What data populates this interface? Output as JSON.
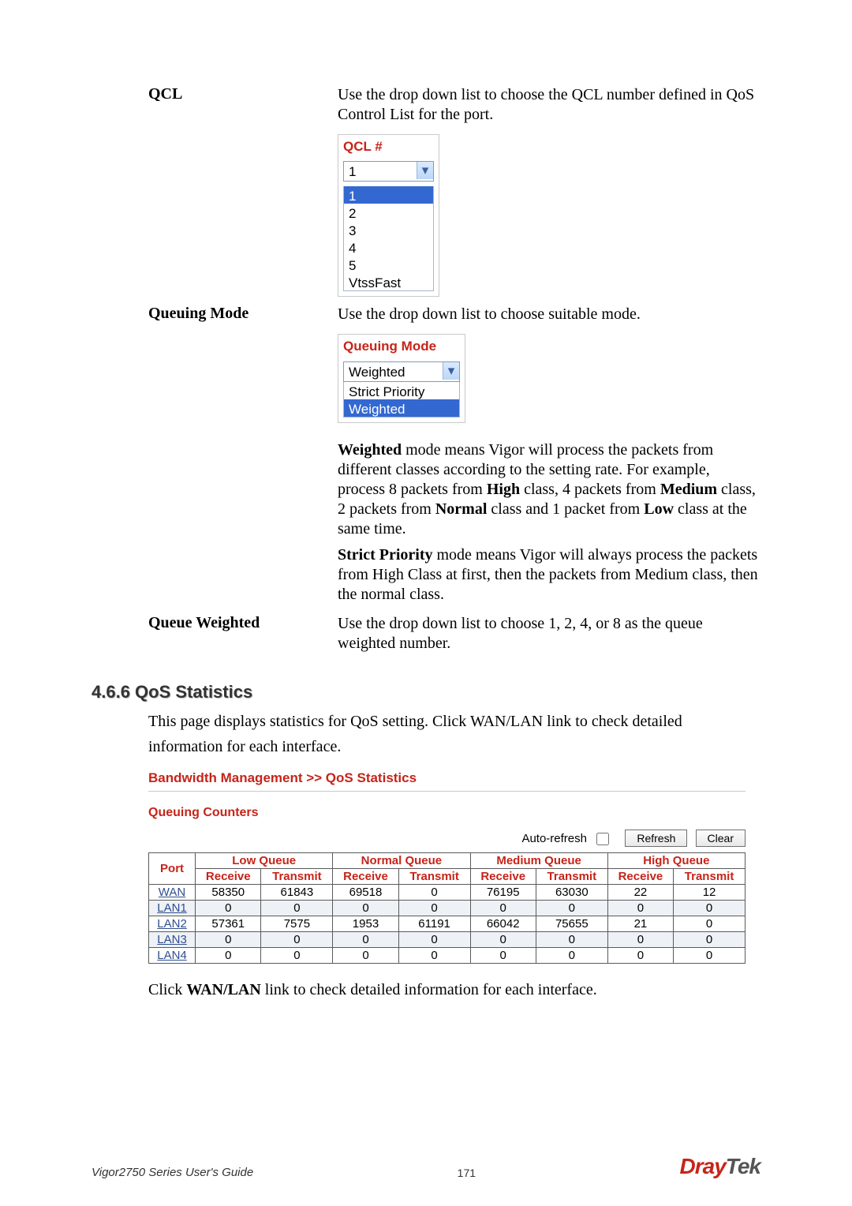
{
  "defs": {
    "qcl": {
      "label": "QCL",
      "text": "Use the drop down list to choose the QCL number defined in QoS Control List for the port.",
      "panel_title": "QCL #",
      "selected": "1",
      "options": [
        "1",
        "2",
        "3",
        "4",
        "5",
        "VtssFast"
      ]
    },
    "queuing_mode": {
      "label": "Queuing Mode",
      "text": "Use the drop down list to choose suitable mode.",
      "panel_title": "Queuing Mode",
      "selected": "Weighted",
      "options": [
        "Strict Priority",
        "Weighted"
      ],
      "weighted_p1_a": "Weighted",
      "weighted_p1_b": " mode means Vigor will process the packets from different classes according to the setting rate. For example, process 8 packets from ",
      "weighted_p1_c": "High",
      "weighted_p1_d": " class, 4 packets from ",
      "weighted_p1_e": "Medium",
      "weighted_p1_f": " class, 2 packets from ",
      "weighted_p1_g": "Normal",
      "weighted_p1_h": " class and 1 packet from ",
      "weighted_p1_i": "Low",
      "weighted_p1_j": " class at the same time.",
      "strict_a": "Strict Priority",
      "strict_b": " mode means Vigor will always process the packets from High Class at first, then the packets from Medium class, then the normal class."
    },
    "queue_weighted": {
      "label": "Queue Weighted",
      "text": "Use the drop down list to choose 1, 2, 4, or 8 as the queue weighted number."
    }
  },
  "section": {
    "heading": "4.6.6 QoS Statistics",
    "intro": "This page displays statistics for QoS setting. Click WAN/LAN link to check detailed information for each interface."
  },
  "stats": {
    "title": "Bandwidth Management >> QoS Statistics",
    "sub": "Queuing Counters",
    "auto_refresh": "Auto-refresh",
    "refresh": "Refresh",
    "clear": "Clear",
    "headers": {
      "port": "Port",
      "groups": [
        "Low Queue",
        "Normal Queue",
        "Medium Queue",
        "High Queue"
      ],
      "sub": [
        "Receive",
        "Transmit"
      ]
    },
    "rows": [
      {
        "port": "WAN",
        "cells": [
          "58350",
          "61843",
          "69518",
          "0",
          "76195",
          "63030",
          "22",
          "12"
        ],
        "even": false
      },
      {
        "port": "LAN1",
        "cells": [
          "0",
          "0",
          "0",
          "0",
          "0",
          "0",
          "0",
          "0"
        ],
        "even": true
      },
      {
        "port": "LAN2",
        "cells": [
          "57361",
          "7575",
          "1953",
          "61191",
          "66042",
          "75655",
          "21",
          "0"
        ],
        "even": false
      },
      {
        "port": "LAN3",
        "cells": [
          "0",
          "0",
          "0",
          "0",
          "0",
          "0",
          "0",
          "0"
        ],
        "even": true
      },
      {
        "port": "LAN4",
        "cells": [
          "0",
          "0",
          "0",
          "0",
          "0",
          "0",
          "0",
          "0"
        ],
        "even": false
      }
    ]
  },
  "footnote_a": "Click ",
  "footnote_b": "WAN/LAN",
  "footnote_c": " link to check detailed information for each interface.",
  "footer": {
    "guide": "Vigor2750 Series User's Guide",
    "page": "171",
    "brand_a": "Dray",
    "brand_b": "Tek"
  }
}
